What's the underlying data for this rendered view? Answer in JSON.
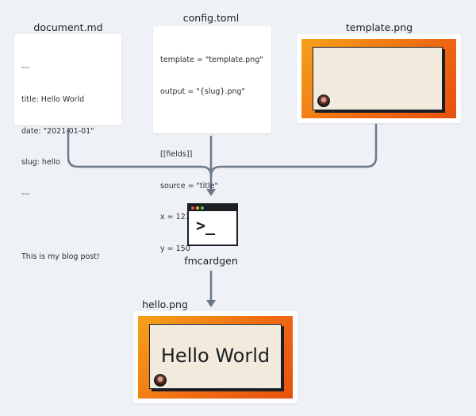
{
  "inputs": {
    "document": {
      "filename": "document.md",
      "lines": [
        "---",
        "title: Hello World",
        "date: \"2021-01-01\"",
        "slug: hello",
        "---",
        "",
        "This is my blog post!"
      ]
    },
    "config": {
      "filename": "config.toml",
      "lines": [
        "template = \"template.png\"",
        "output = \"{slug}.png\"",
        "",
        "[[fields]]",
        "source = \"title\"",
        "x = 123",
        "y = 150"
      ]
    },
    "template": {
      "filename": "template.png"
    }
  },
  "tool": {
    "name": "fmcardgen",
    "icon": "terminal-icon"
  },
  "output": {
    "filename": "hello.png",
    "text": "Hello World"
  },
  "colors": {
    "arrow": "#6b7887",
    "frame": "#ef6c12",
    "card_bg": "#f2eadd",
    "ink": "#1b1f24"
  }
}
